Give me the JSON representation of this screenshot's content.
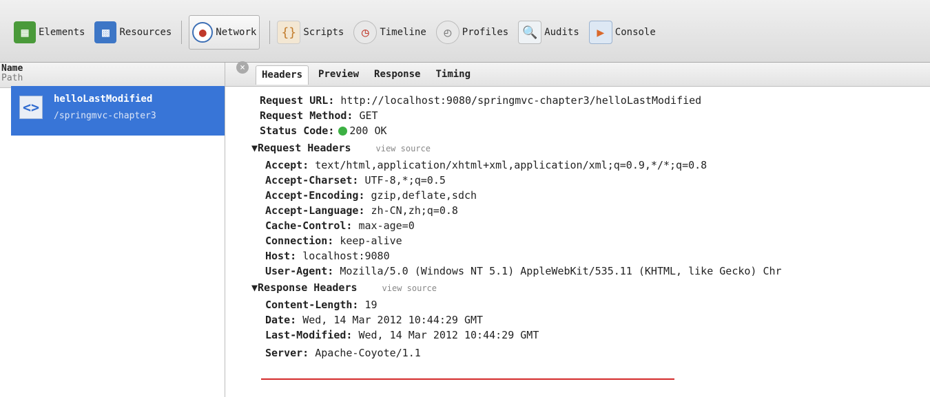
{
  "toolbar": {
    "items": [
      {
        "label": "Elements",
        "icon": "elements-icon",
        "color": "#4a9a3a"
      },
      {
        "label": "Resources",
        "icon": "resources-icon",
        "color": "#3d76c6"
      },
      {
        "label": "Network",
        "icon": "network-icon",
        "color": "#c0392b"
      },
      {
        "label": "Scripts",
        "icon": "scripts-icon",
        "color": "#c27c2c"
      },
      {
        "label": "Timeline",
        "icon": "timeline-icon",
        "color": "#8a8a8a"
      },
      {
        "label": "Profiles",
        "icon": "profiles-icon",
        "color": "#8a8a8a"
      },
      {
        "label": "Audits",
        "icon": "audits-icon",
        "color": "#6f8a9c"
      },
      {
        "label": "Console",
        "icon": "console-icon",
        "color": "#d9692c"
      }
    ]
  },
  "list": {
    "header_name": "Name",
    "header_path": "Path",
    "request": {
      "name": "helloLastModified",
      "path": "/springmvc-chapter3",
      "icon_glyph": "<>"
    }
  },
  "detail": {
    "tabs": [
      "Headers",
      "Preview",
      "Response",
      "Timing"
    ],
    "general": {
      "url_key": "Request URL:",
      "url_val": "http://localhost:9080/springmvc-chapter3/helloLastModified",
      "method_key": "Request Method:",
      "method_val": "GET",
      "status_key": "Status Code:",
      "status_val": "200 OK"
    },
    "request_headers": {
      "title": "Request Headers",
      "view_source": "view source",
      "rows": [
        {
          "k": "Accept:",
          "v": "text/html,application/xhtml+xml,application/xml;q=0.9,*/*;q=0.8"
        },
        {
          "k": "Accept-Charset:",
          "v": "UTF-8,*;q=0.5"
        },
        {
          "k": "Accept-Encoding:",
          "v": "gzip,deflate,sdch"
        },
        {
          "k": "Accept-Language:",
          "v": "zh-CN,zh;q=0.8"
        },
        {
          "k": "Cache-Control:",
          "v": "max-age=0"
        },
        {
          "k": "Connection:",
          "v": "keep-alive"
        },
        {
          "k": "Host:",
          "v": "localhost:9080"
        },
        {
          "k": "User-Agent:",
          "v": "Mozilla/5.0 (Windows NT 5.1) AppleWebKit/535.11 (KHTML, like Gecko) Chr"
        }
      ]
    },
    "response_headers": {
      "title": "Response Headers",
      "view_source": "view source",
      "rows": [
        {
          "k": "Content-Length:",
          "v": "19"
        },
        {
          "k": "Date:",
          "v": "Wed, 14 Mar 2012 10:44:29 GMT"
        },
        {
          "k": "Last-Modified:",
          "v": "Wed, 14 Mar 2012 10:44:29 GMT"
        },
        {
          "k": "Server:",
          "v": "Apache-Coyote/1.1"
        }
      ]
    }
  }
}
